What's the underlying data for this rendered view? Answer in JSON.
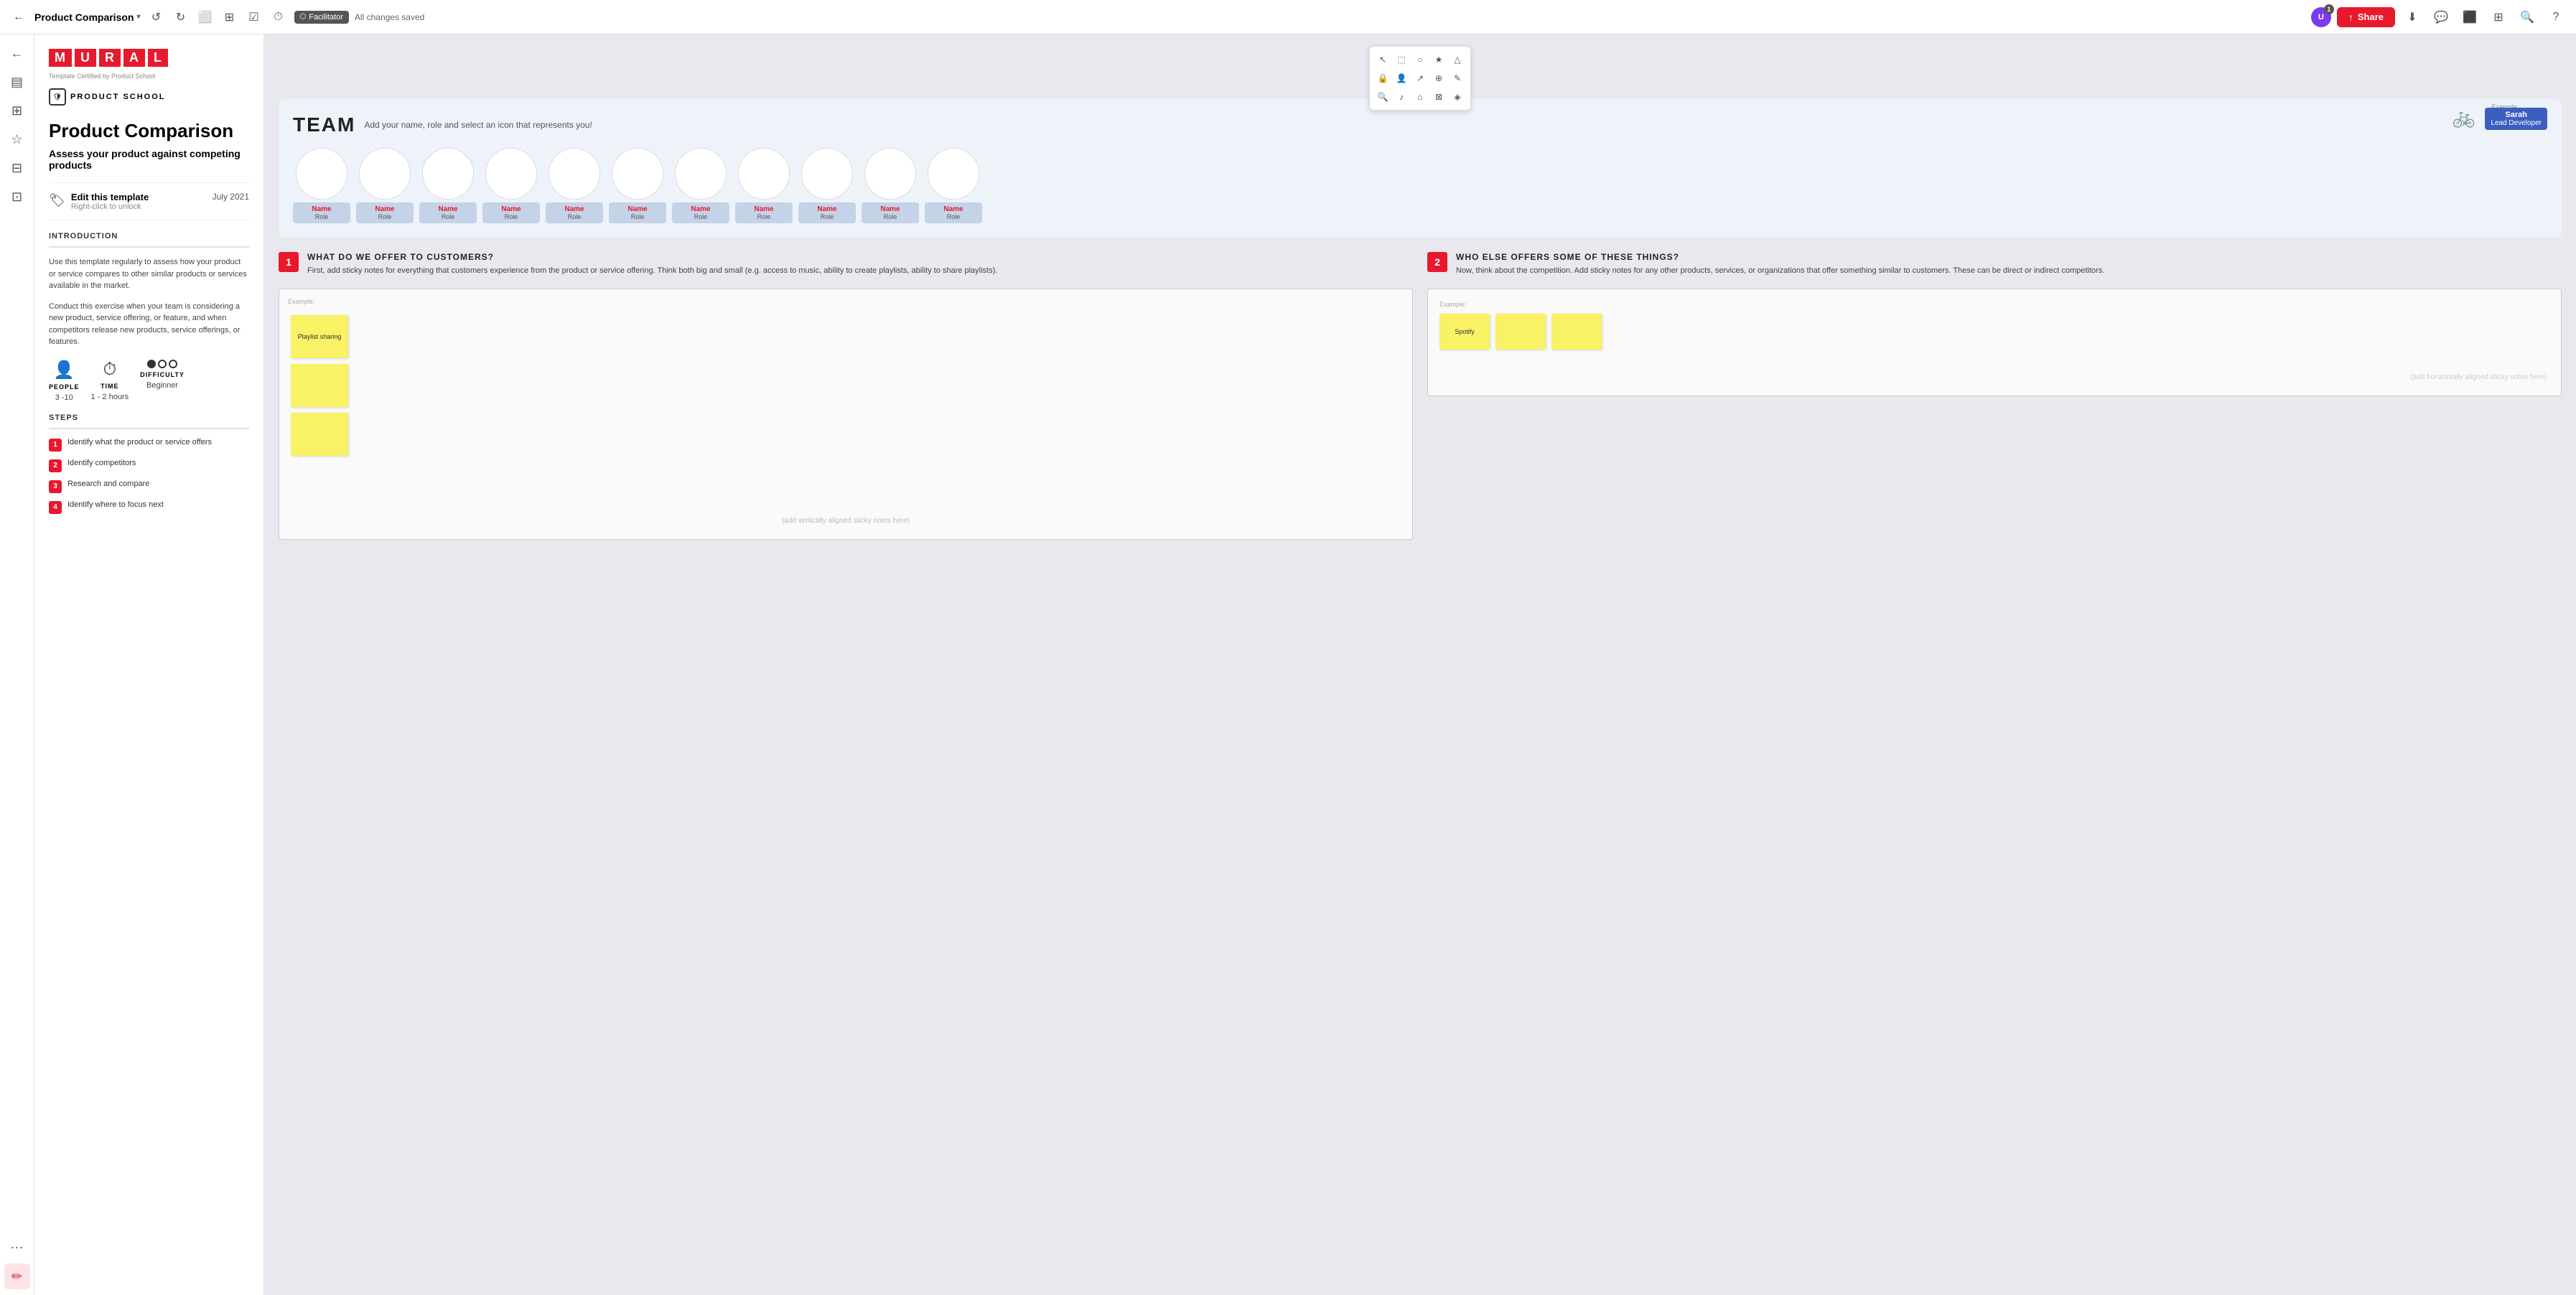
{
  "topbar": {
    "title": "Product Comparison",
    "saved_text": "All changes saved",
    "facilitator_label": "Facilitator",
    "share_label": "Share"
  },
  "left_sidebar": {
    "icons": [
      {
        "name": "back-icon",
        "symbol": "←"
      },
      {
        "name": "sticky-icon",
        "symbol": "▤"
      },
      {
        "name": "layers-icon",
        "symbol": "⊞"
      },
      {
        "name": "star-icon",
        "symbol": "☆"
      },
      {
        "name": "grid-icon",
        "symbol": "⊟"
      },
      {
        "name": "integration-icon",
        "symbol": "⊡"
      },
      {
        "name": "comments-icon",
        "symbol": "⋯"
      },
      {
        "name": "pen-icon",
        "symbol": "✏"
      }
    ]
  },
  "panel": {
    "logo_letters": [
      "M",
      "U",
      "R",
      "A",
      "L"
    ],
    "certified_text": "Template Certified by Product School",
    "school_name": "PRODUCT SCHOOL",
    "title": "Product Comparison",
    "subtitle": "Assess your product against competing products",
    "lock_title": "Edit this template",
    "lock_subtitle": "Right-click to unlock",
    "date": "July 2021",
    "intro_title": "INTRODUCTION",
    "intro_p1": "Use this template regularly to assess how your product or service compares to other similar products or services available in the market.",
    "intro_p2": "Conduct this exercise when your team is considering a new product, service offering, or feature, and when competitors release new products, service offerings, or features.",
    "stats": {
      "people_label": "PEOPLE",
      "people_value": "3 -10",
      "time_label": "TIME",
      "time_value": "1 - 2 hours",
      "difficulty_label": "DIFFICULTY",
      "difficulty_value": "Beginner"
    },
    "steps_title": "STEPS",
    "steps": [
      "Identify what the product or service offers",
      "Identify competitors",
      "Research and compare",
      "Identify where to focus next"
    ]
  },
  "canvas": {
    "team_label": "TEAM",
    "team_instruction": "Add your name, role and select an icon that represents you!",
    "team_example_text": "Example:",
    "example_card": {
      "name": "Sarah",
      "role": "Lead Developer"
    },
    "members": [
      {
        "name": "Name",
        "role": "Role"
      },
      {
        "name": "Name",
        "role": "Role"
      },
      {
        "name": "Name",
        "role": "Role"
      },
      {
        "name": "Name",
        "role": "Role"
      },
      {
        "name": "Name",
        "role": "Role"
      },
      {
        "name": "Name",
        "role": "Role"
      },
      {
        "name": "Name",
        "role": "Role"
      },
      {
        "name": "Name",
        "role": "Role"
      },
      {
        "name": "Name",
        "role": "Role"
      },
      {
        "name": "Name",
        "role": "Role"
      },
      {
        "name": "Name",
        "role": "Role"
      }
    ],
    "section1": {
      "num": "1",
      "heading": "WHAT DO WE OFFER TO CUSTOMERS?",
      "desc": "First, add sticky notes for everything that customers experience from the product or service offering. Think both big and small (e.g. access to music, ability to create playlists, ability to share playlists)."
    },
    "section2": {
      "num": "2",
      "heading": "WHO ELSE OFFERS SOME OF THESE THINGS?",
      "desc": "Now, think about the competition. Add sticky notes for any other products, services, or organizations that offer something similar to customers. These can be direct or indirect competitors."
    },
    "section1_example": "Example:",
    "section1_sticky_label": "Playlist sharing",
    "section1_placeholder": "(add vertically aligned sticky notes here)",
    "section2_example": "Example:",
    "section2_sticky1": "Spotify",
    "section2_placeholder": "(add horizontally aligned sticky notes here)"
  },
  "toolbar": {
    "buttons": [
      "○",
      "◻",
      "△",
      "★",
      "●",
      "♦",
      "⌂",
      "↗",
      "⊕",
      "✎",
      "⊘",
      "♪",
      "⊡",
      "⊠",
      "◈"
    ]
  }
}
